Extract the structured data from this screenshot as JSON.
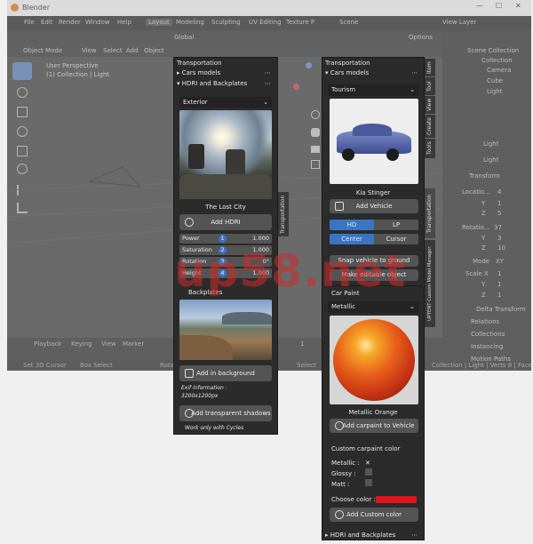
{
  "window": {
    "title": "Blender"
  },
  "menubar": {
    "items": [
      "File",
      "Edit",
      "Render",
      "Window",
      "Help"
    ],
    "workspaces": [
      "Layout",
      "Modeling",
      "Sculpting",
      "UV Editing",
      "Texture P"
    ],
    "scene": "Scene",
    "view_layer": "View Layer"
  },
  "toolheader": {
    "transform": "Global",
    "options": "Options"
  },
  "viewport_header": {
    "mode": "Object Mode",
    "menus": [
      "View",
      "Select",
      "Add",
      "Object"
    ]
  },
  "viewport": {
    "view_name": "User Perspective",
    "collection": "(1) Collection | Light"
  },
  "outliner": {
    "title": "Scene Collection",
    "items": [
      "Collection",
      "Camera",
      "Cube",
      "Light"
    ]
  },
  "properties": {
    "object": "Light",
    "name_field": "Light",
    "section": "Transform",
    "location_label": "Locatio...",
    "location": [
      "4",
      "1",
      "5"
    ],
    "rotation_label": "Rotatio...",
    "rotation": [
      "37",
      "3",
      "10"
    ],
    "mode_label": "Mode",
    "mode": "XY",
    "scale_label": "Scale X",
    "scale": [
      "1",
      "1",
      "1"
    ],
    "axes": [
      "X",
      "Y",
      "Z"
    ],
    "collapsed": [
      "Delta Transform",
      "Relations",
      "Collections",
      "Instancing",
      "Motion Paths"
    ]
  },
  "timeline": {
    "items": [
      "Playback",
      "Keying",
      "View",
      "Marker"
    ],
    "frame": "1"
  },
  "statusbar": {
    "items": [
      "Set 3D Cursor",
      "Box Select",
      "Rotat",
      "Select",
      "Collection | Light | Verts 8 | Faces"
    ]
  },
  "left_panel": {
    "title": "Transportation",
    "cars_models": "Cars models",
    "hdri_section": "HDRI and Backplates",
    "dropdown": "Exterior",
    "image_caption": "The Lost City",
    "add_hdri": "Add HDRI",
    "sliders": [
      {
        "label": "Power",
        "num": "1",
        "value": "1.000"
      },
      {
        "label": "Saturation",
        "num": "2",
        "value": "1.000"
      },
      {
        "label": "Rotation",
        "num": "3",
        "value": "0°"
      },
      {
        "label": "Height",
        "num": "4",
        "value": "1.000"
      }
    ],
    "backplates": "Backplates",
    "add_background": "Add in background",
    "exif": "Exif information :",
    "exif_size": "3200x1200px",
    "add_shadows": "Add transparent shadows",
    "note": "Work only with Cycles",
    "side_tab": "Transportation"
  },
  "right_panel": {
    "title": "Transportation",
    "cars_models": "Cars models",
    "dropdown": "Tourism",
    "car_name": "Kia Stinger",
    "add_vehicle": "Add Vehicle",
    "quality": [
      "HD",
      "LP"
    ],
    "alignment": [
      "Center",
      "Cursor"
    ],
    "snap": "Snap vehicle to ground",
    "editable": "Make editable object",
    "car_paint": "Car Paint",
    "paint_type": "Metallic",
    "paint_name": "Metallic Orange",
    "add_carpaint": "Add carpaint to Vehicle",
    "custom_title": "Custom carpaint color",
    "checks": [
      {
        "label": "Metallic :",
        "checked": true
      },
      {
        "label": "Glossy :",
        "checked": false
      },
      {
        "label": "Matt :",
        "checked": false
      }
    ],
    "choose_color": "Choose color :",
    "choose_color_value": "#e0141a",
    "add_custom": "Add Custom color",
    "hdri_section": "HDRI and Backplates",
    "side_tabs": [
      "Item",
      "Tool",
      "View",
      "Create",
      "Tools",
      "Transportation",
      "UPTENT Custom Model Manager"
    ]
  },
  "watermark": {
    "text": "up58.net"
  },
  "colors": {
    "accent_blue": "#3a75c4",
    "pink_watermark": "#d02a2a"
  }
}
